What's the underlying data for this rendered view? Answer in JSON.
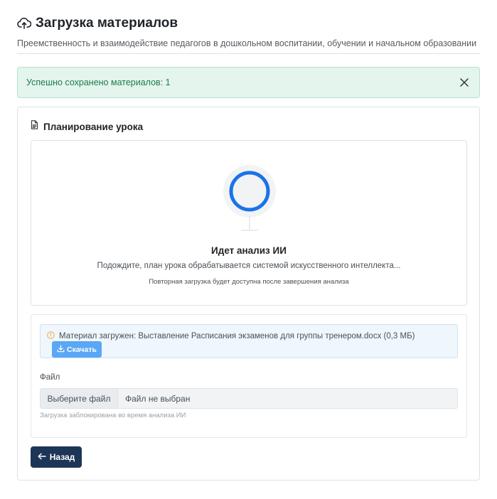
{
  "header": {
    "title": "Загрузка материалов",
    "subtitle": "Преемственность и взаимодействие педагогов в дошкольном воспитании, обучении и начальном образовании",
    "icon": "cloud-upload-icon"
  },
  "alert": {
    "message": "Успешно сохранено материалов: 1",
    "close_icon": "close-icon",
    "color": "#1e7a4e"
  },
  "section": {
    "title": "Планирование урока",
    "icon": "document-icon"
  },
  "analysis": {
    "title": "Идет анализ ИИ",
    "description": "Подождите, план урока обрабатывается системой искусственного интеллекта...",
    "note": "Повторная загрузка будет доступна после завершения анализа",
    "spinner_color": "#1a73e8"
  },
  "upload": {
    "info_text": "Материал загружен: Выставление Расписания экзаменов для группы тренером.docx (0,3 МБ)",
    "info_icon": "warning-circle-icon",
    "download_label": "Скачать",
    "download_icon": "download-icon",
    "file_label": "Файл",
    "choose_label": "Выберите файл",
    "no_file_label": "Файл не выбран",
    "hint": "Загрузка заблокирована во время анализа ИИ"
  },
  "back": {
    "label": "Назад",
    "icon": "arrow-left-icon",
    "color": "#1d3557"
  }
}
